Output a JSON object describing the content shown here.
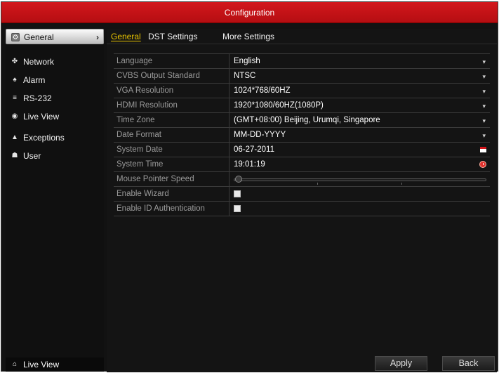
{
  "window": {
    "title": "Configuration"
  },
  "sidebar": {
    "items": [
      {
        "label": "General",
        "icon": "gear-icon",
        "glyph": "⚙"
      },
      {
        "label": "Network",
        "icon": "network-icon",
        "glyph": "✤"
      },
      {
        "label": "Alarm",
        "icon": "alarm-icon",
        "glyph": "♠"
      },
      {
        "label": "RS-232",
        "icon": "rs232-icon",
        "glyph": "≡"
      },
      {
        "label": "Live View",
        "icon": "eye-icon",
        "glyph": "◉"
      },
      {
        "label": "Exceptions",
        "icon": "warning-icon",
        "glyph": "▲"
      },
      {
        "label": "User",
        "icon": "user-icon",
        "glyph": "☗"
      }
    ],
    "active_index": 0,
    "active_arrow": "›",
    "bottom": {
      "label": "Live View",
      "icon": "home-icon",
      "glyph": "⌂"
    }
  },
  "tabs": [
    {
      "label": "General"
    },
    {
      "label": "DST Settings"
    },
    {
      "label": "More Settings"
    }
  ],
  "settings": {
    "language": {
      "label": "Language",
      "value": "English"
    },
    "cvbs": {
      "label": "CVBS Output Standard",
      "value": "NTSC"
    },
    "vga": {
      "label": "VGA Resolution",
      "value": "1024*768/60HZ"
    },
    "hdmi": {
      "label": "HDMI Resolution",
      "value": "1920*1080/60HZ(1080P)"
    },
    "timezone": {
      "label": "Time Zone",
      "value": "(GMT+08:00) Beijing, Urumqi, Singapore"
    },
    "date_format": {
      "label": "Date Format",
      "value": "MM-DD-YYYY"
    },
    "system_date": {
      "label": "System Date",
      "value": "06-27-2011"
    },
    "system_time": {
      "label": "System Time",
      "value": "19:01:19"
    },
    "mouse_speed": {
      "label": "Mouse Pointer Speed",
      "level": 0.0
    },
    "enable_wizard": {
      "label": "Enable Wizard",
      "checked": false
    },
    "enable_id_auth": {
      "label": "Enable ID Authentication",
      "checked": false
    }
  },
  "buttons": {
    "apply": "Apply",
    "back": "Back"
  },
  "colors": {
    "title_bar": "#c8141a",
    "active_tab": "#e8c400"
  },
  "icons": {
    "dropdown": "▾"
  }
}
